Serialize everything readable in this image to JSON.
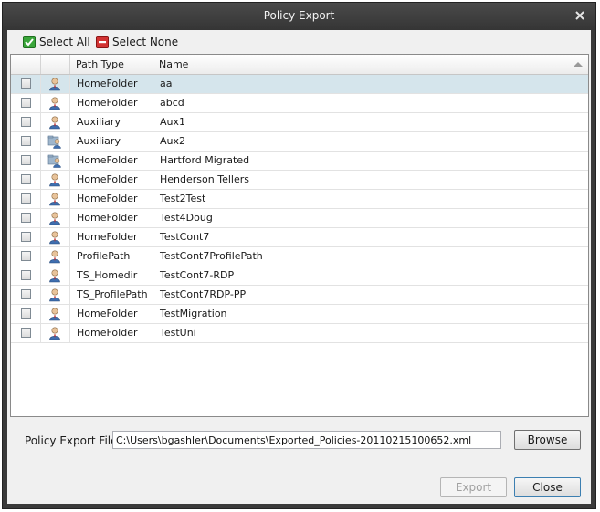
{
  "window": {
    "title": "Policy Export"
  },
  "toolbar": {
    "select_all": "Select All",
    "select_none": "Select None"
  },
  "grid": {
    "columns": {
      "path_type": "Path Type",
      "name": "Name"
    },
    "rows": [
      {
        "path_type": "HomeFolder",
        "name": "aa",
        "icon": "user-icon",
        "selected": true,
        "checked": false
      },
      {
        "path_type": "HomeFolder",
        "name": "abcd",
        "icon": "user-icon",
        "selected": false,
        "checked": false
      },
      {
        "path_type": "Auxiliary",
        "name": "Aux1",
        "icon": "user-icon",
        "selected": false,
        "checked": false
      },
      {
        "path_type": "Auxiliary",
        "name": "Aux2",
        "icon": "user-folder-icon",
        "selected": false,
        "checked": false
      },
      {
        "path_type": "HomeFolder",
        "name": "Hartford Migrated",
        "icon": "user-folder-icon",
        "selected": false,
        "checked": false
      },
      {
        "path_type": "HomeFolder",
        "name": "Henderson Tellers",
        "icon": "user-icon",
        "selected": false,
        "checked": false
      },
      {
        "path_type": "HomeFolder",
        "name": "Test2Test",
        "icon": "user-icon",
        "selected": false,
        "checked": false
      },
      {
        "path_type": "HomeFolder",
        "name": "Test4Doug",
        "icon": "user-icon",
        "selected": false,
        "checked": false
      },
      {
        "path_type": "HomeFolder",
        "name": "TestCont7",
        "icon": "user-icon",
        "selected": false,
        "checked": false
      },
      {
        "path_type": "ProfilePath",
        "name": "TestCont7ProfilePath",
        "icon": "user-icon",
        "selected": false,
        "checked": false
      },
      {
        "path_type": "TS_Homedir",
        "name": "TestCont7-RDP",
        "icon": "user-icon",
        "selected": false,
        "checked": false
      },
      {
        "path_type": "TS_ProfilePath",
        "name": "TestCont7RDP-PP",
        "icon": "user-icon",
        "selected": false,
        "checked": false
      },
      {
        "path_type": "HomeFolder",
        "name": "TestMigration",
        "icon": "user-icon",
        "selected": false,
        "checked": false
      },
      {
        "path_type": "HomeFolder",
        "name": "TestUni",
        "icon": "user-icon",
        "selected": false,
        "checked": false
      }
    ]
  },
  "export_file": {
    "label": "Policy Export File",
    "value": "C:\\Users\\bgashler\\Documents\\Exported_Policies-20110215100652.xml",
    "browse": "Browse"
  },
  "buttons": {
    "export": "Export",
    "close": "Close"
  },
  "colors": {
    "title_bar": "#3a3a3a",
    "selected_row": "#d5e5ec",
    "check_green": "#2e9b2e",
    "none_red": "#c72a2a"
  }
}
